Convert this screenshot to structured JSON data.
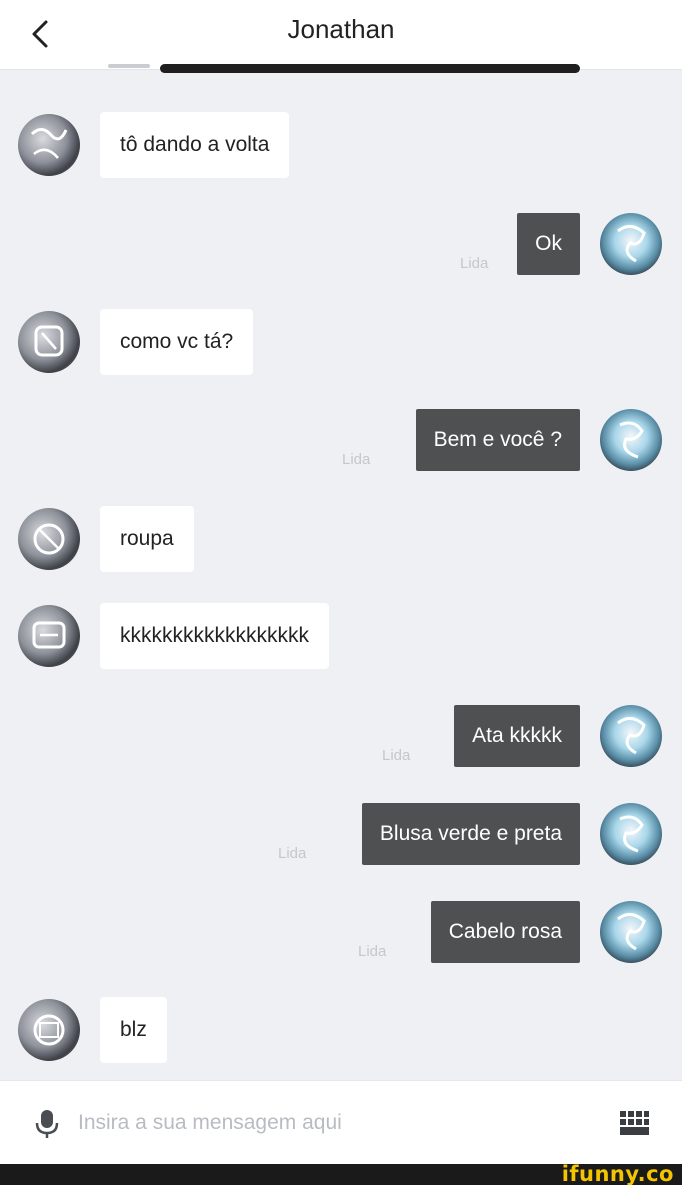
{
  "header": {
    "title": "Jonathan"
  },
  "messages": [
    {
      "side": "in",
      "text": "tô dando a volta"
    },
    {
      "side": "out",
      "text": "Ok",
      "status": "Lida"
    },
    {
      "side": "in",
      "text": "como vc tá?"
    },
    {
      "side": "out",
      "text": "Bem e você ?",
      "status": "Lida"
    },
    {
      "side": "in",
      "text": "roupa"
    },
    {
      "side": "in",
      "text": "kkkkkkkkkkkkkkkkkk"
    },
    {
      "side": "out",
      "text": "Ata kkkkk",
      "status": "Lida"
    },
    {
      "side": "out",
      "text": "Blusa verde e preta",
      "status": "Lida"
    },
    {
      "side": "out",
      "text": "Cabelo rosa",
      "status": "Lida"
    },
    {
      "side": "in",
      "text": "blz"
    }
  ],
  "composer": {
    "placeholder": "Insira a sua mensagem aqui",
    "mic_icon": "microphone-icon",
    "keyboard_icon": "keyboard-icon"
  },
  "watermark": {
    "text": "ifunny.co"
  },
  "colors": {
    "background": "#eef0f3",
    "incoming_bubble": "#ffffff",
    "outgoing_bubble": "#4e5052",
    "read_status": "#c4c8cd",
    "watermark": "#f5c400"
  }
}
